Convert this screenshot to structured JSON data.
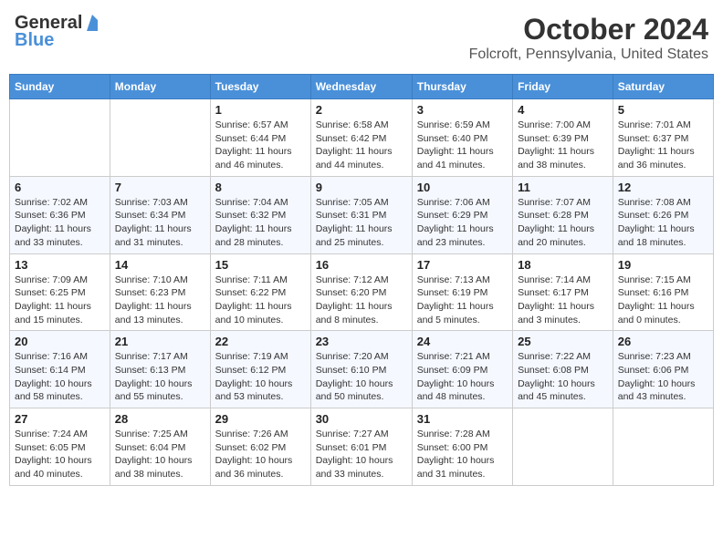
{
  "header": {
    "logo_general": "General",
    "logo_blue": "Blue",
    "month": "October 2024",
    "location": "Folcroft, Pennsylvania, United States"
  },
  "days_of_week": [
    "Sunday",
    "Monday",
    "Tuesday",
    "Wednesday",
    "Thursday",
    "Friday",
    "Saturday"
  ],
  "weeks": [
    [
      {
        "day": "",
        "info": ""
      },
      {
        "day": "",
        "info": ""
      },
      {
        "day": "1",
        "info": "Sunrise: 6:57 AM\nSunset: 6:44 PM\nDaylight: 11 hours and 46 minutes."
      },
      {
        "day": "2",
        "info": "Sunrise: 6:58 AM\nSunset: 6:42 PM\nDaylight: 11 hours and 44 minutes."
      },
      {
        "day": "3",
        "info": "Sunrise: 6:59 AM\nSunset: 6:40 PM\nDaylight: 11 hours and 41 minutes."
      },
      {
        "day": "4",
        "info": "Sunrise: 7:00 AM\nSunset: 6:39 PM\nDaylight: 11 hours and 38 minutes."
      },
      {
        "day": "5",
        "info": "Sunrise: 7:01 AM\nSunset: 6:37 PM\nDaylight: 11 hours and 36 minutes."
      }
    ],
    [
      {
        "day": "6",
        "info": "Sunrise: 7:02 AM\nSunset: 6:36 PM\nDaylight: 11 hours and 33 minutes."
      },
      {
        "day": "7",
        "info": "Sunrise: 7:03 AM\nSunset: 6:34 PM\nDaylight: 11 hours and 31 minutes."
      },
      {
        "day": "8",
        "info": "Sunrise: 7:04 AM\nSunset: 6:32 PM\nDaylight: 11 hours and 28 minutes."
      },
      {
        "day": "9",
        "info": "Sunrise: 7:05 AM\nSunset: 6:31 PM\nDaylight: 11 hours and 25 minutes."
      },
      {
        "day": "10",
        "info": "Sunrise: 7:06 AM\nSunset: 6:29 PM\nDaylight: 11 hours and 23 minutes."
      },
      {
        "day": "11",
        "info": "Sunrise: 7:07 AM\nSunset: 6:28 PM\nDaylight: 11 hours and 20 minutes."
      },
      {
        "day": "12",
        "info": "Sunrise: 7:08 AM\nSunset: 6:26 PM\nDaylight: 11 hours and 18 minutes."
      }
    ],
    [
      {
        "day": "13",
        "info": "Sunrise: 7:09 AM\nSunset: 6:25 PM\nDaylight: 11 hours and 15 minutes."
      },
      {
        "day": "14",
        "info": "Sunrise: 7:10 AM\nSunset: 6:23 PM\nDaylight: 11 hours and 13 minutes."
      },
      {
        "day": "15",
        "info": "Sunrise: 7:11 AM\nSunset: 6:22 PM\nDaylight: 11 hours and 10 minutes."
      },
      {
        "day": "16",
        "info": "Sunrise: 7:12 AM\nSunset: 6:20 PM\nDaylight: 11 hours and 8 minutes."
      },
      {
        "day": "17",
        "info": "Sunrise: 7:13 AM\nSunset: 6:19 PM\nDaylight: 11 hours and 5 minutes."
      },
      {
        "day": "18",
        "info": "Sunrise: 7:14 AM\nSunset: 6:17 PM\nDaylight: 11 hours and 3 minutes."
      },
      {
        "day": "19",
        "info": "Sunrise: 7:15 AM\nSunset: 6:16 PM\nDaylight: 11 hours and 0 minutes."
      }
    ],
    [
      {
        "day": "20",
        "info": "Sunrise: 7:16 AM\nSunset: 6:14 PM\nDaylight: 10 hours and 58 minutes."
      },
      {
        "day": "21",
        "info": "Sunrise: 7:17 AM\nSunset: 6:13 PM\nDaylight: 10 hours and 55 minutes."
      },
      {
        "day": "22",
        "info": "Sunrise: 7:19 AM\nSunset: 6:12 PM\nDaylight: 10 hours and 53 minutes."
      },
      {
        "day": "23",
        "info": "Sunrise: 7:20 AM\nSunset: 6:10 PM\nDaylight: 10 hours and 50 minutes."
      },
      {
        "day": "24",
        "info": "Sunrise: 7:21 AM\nSunset: 6:09 PM\nDaylight: 10 hours and 48 minutes."
      },
      {
        "day": "25",
        "info": "Sunrise: 7:22 AM\nSunset: 6:08 PM\nDaylight: 10 hours and 45 minutes."
      },
      {
        "day": "26",
        "info": "Sunrise: 7:23 AM\nSunset: 6:06 PM\nDaylight: 10 hours and 43 minutes."
      }
    ],
    [
      {
        "day": "27",
        "info": "Sunrise: 7:24 AM\nSunset: 6:05 PM\nDaylight: 10 hours and 40 minutes."
      },
      {
        "day": "28",
        "info": "Sunrise: 7:25 AM\nSunset: 6:04 PM\nDaylight: 10 hours and 38 minutes."
      },
      {
        "day": "29",
        "info": "Sunrise: 7:26 AM\nSunset: 6:02 PM\nDaylight: 10 hours and 36 minutes."
      },
      {
        "day": "30",
        "info": "Sunrise: 7:27 AM\nSunset: 6:01 PM\nDaylight: 10 hours and 33 minutes."
      },
      {
        "day": "31",
        "info": "Sunrise: 7:28 AM\nSunset: 6:00 PM\nDaylight: 10 hours and 31 minutes."
      },
      {
        "day": "",
        "info": ""
      },
      {
        "day": "",
        "info": ""
      }
    ]
  ]
}
